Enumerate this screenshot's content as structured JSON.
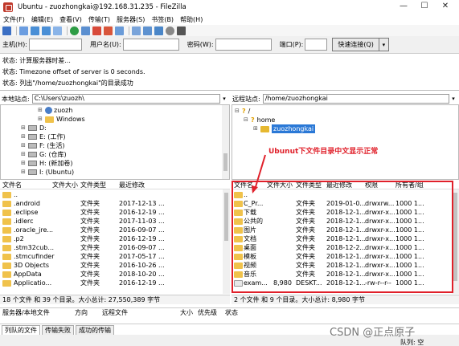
{
  "window": {
    "title": "Ubuntu - zuozhongkai@192.168.31.235 - FileZilla",
    "controls": [
      "—",
      "☐",
      "✕"
    ]
  },
  "menu": [
    "文件(F)",
    "编辑(E)",
    "查看(V)",
    "传输(T)",
    "服务器(S)",
    "书签(B)",
    "帮助(H)"
  ],
  "quickconnect": {
    "host_label": "主机(H):",
    "user_label": "用户名(U):",
    "pass_label": "密码(W):",
    "port_label": "端口(P):",
    "button": "快速连接(Q)",
    "host_value": "",
    "user_value": "",
    "pass_value": "",
    "port_value": ""
  },
  "log": [
    "状态:  计算服务器时差...",
    "状态:  Timezone offset of server is 0 seconds.",
    "状态:  列出\"/home/zuozhongkai\"的目录成功"
  ],
  "local": {
    "site_label": "本地站点:",
    "path": "C:\\Users\\zuozh\\",
    "tree": [
      {
        "label": "zuozh",
        "kind": "user"
      },
      {
        "label": "Windows",
        "kind": "folder"
      },
      {
        "label": "D:",
        "kind": "drive"
      },
      {
        "label": "E: (工作)",
        "kind": "drive"
      },
      {
        "label": "F: (生活)",
        "kind": "drive"
      },
      {
        "label": "G: (仓库)",
        "kind": "drive"
      },
      {
        "label": "H: (新加卷)",
        "kind": "drive"
      },
      {
        "label": "I: (Ubuntu)",
        "kind": "drive"
      }
    ],
    "columns": [
      "文件名",
      "文件大小",
      "文件类型",
      "最近修改"
    ],
    "files": [
      {
        "name": "..",
        "size": "",
        "type": "",
        "modified": ""
      },
      {
        "name": ".android",
        "size": "",
        "type": "文件夹",
        "modified": "2017-12-13 ..."
      },
      {
        "name": ".eclipse",
        "size": "",
        "type": "文件夹",
        "modified": "2016-12-19 ..."
      },
      {
        "name": ".idlerc",
        "size": "",
        "type": "文件夹",
        "modified": "2017-11-03 ..."
      },
      {
        "name": ".oracle_jre...",
        "size": "",
        "type": "文件夹",
        "modified": "2016-09-07 ..."
      },
      {
        "name": ".p2",
        "size": "",
        "type": "文件夹",
        "modified": "2016-12-19 ..."
      },
      {
        "name": ".stm32cub...",
        "size": "",
        "type": "文件夹",
        "modified": "2016-09-07 ..."
      },
      {
        "name": ".stmcufinder",
        "size": "",
        "type": "文件夹",
        "modified": "2017-05-17 ..."
      },
      {
        "name": "3D Objects",
        "size": "",
        "type": "文件夹",
        "modified": "2016-10-26 ..."
      },
      {
        "name": "AppData",
        "size": "",
        "type": "文件夹",
        "modified": "2018-10-20 ..."
      },
      {
        "name": "Applicatio...",
        "size": "",
        "type": "文件夹",
        "modified": "2016-12-19 ..."
      }
    ],
    "status": "18 个文件 和 39 个目录。大小总计: 27,550,389 字节"
  },
  "remote": {
    "site_label": "远程站点:",
    "path": "/home/zuozhongkai",
    "tree": [
      {
        "label": "/",
        "kind": "q"
      },
      {
        "label": "home",
        "kind": "q"
      },
      {
        "label": "zuozhongkai",
        "kind": "folder"
      }
    ],
    "columns": [
      "文件名",
      "文件大小",
      "文件类型",
      "最近修改",
      "权限",
      "所有者/组"
    ],
    "files": [
      {
        "name": "..",
        "size": "",
        "type": "",
        "modified": "",
        "perm": "",
        "owner": ""
      },
      {
        "name": "C_Pr...",
        "size": "",
        "type": "文件夹",
        "modified": "2019-01-0...",
        "perm": "drwxrw...",
        "owner": "1000 1..."
      },
      {
        "name": "下载",
        "size": "",
        "type": "文件夹",
        "modified": "2018-12-1...",
        "perm": "drwxr-x...",
        "owner": "1000 1..."
      },
      {
        "name": "公共的",
        "size": "",
        "type": "文件夹",
        "modified": "2018-12-1...",
        "perm": "drwxr-x...",
        "owner": "1000 1..."
      },
      {
        "name": "图片",
        "size": "",
        "type": "文件夹",
        "modified": "2018-12-1...",
        "perm": "drwxr-x...",
        "owner": "1000 1..."
      },
      {
        "name": "文档",
        "size": "",
        "type": "文件夹",
        "modified": "2018-12-1...",
        "perm": "drwxr-x...",
        "owner": "1000 1..."
      },
      {
        "name": "桌面",
        "size": "",
        "type": "文件夹",
        "modified": "2018-12-2...",
        "perm": "drwxr-x...",
        "owner": "1000 1..."
      },
      {
        "name": "模板",
        "size": "",
        "type": "文件夹",
        "modified": "2018-12-1...",
        "perm": "drwxr-x...",
        "owner": "1000 1..."
      },
      {
        "name": "视频",
        "size": "",
        "type": "文件夹",
        "modified": "2018-12-1...",
        "perm": "drwxr-x...",
        "owner": "1000 1..."
      },
      {
        "name": "音乐",
        "size": "",
        "type": "文件夹",
        "modified": "2018-12-1...",
        "perm": "drwxr-x...",
        "owner": "1000 1..."
      },
      {
        "name": "exam...",
        "size": "8,980",
        "type": "DESKT...",
        "modified": "2018-12-1...",
        "perm": "-rw-r--r--",
        "owner": "1000 1..."
      }
    ],
    "status": "2 个文件 和 9 个目录。大小总计: 8,980 字节"
  },
  "annotation": "Ubunut下文件目录中文显示正常",
  "queue": {
    "columns": [
      "服务器/本地文件",
      "方向",
      "远程文件",
      "大小",
      "优先级",
      "状态"
    ],
    "tabs": [
      "列队的文件",
      "传输失败",
      "成功的传输"
    ],
    "status": "队列: 空"
  },
  "watermark": "CSDN @正点原子",
  "colors": {
    "annotation": "#e0202a",
    "folder": "#f0c24b",
    "selection": "#2a78d6"
  }
}
